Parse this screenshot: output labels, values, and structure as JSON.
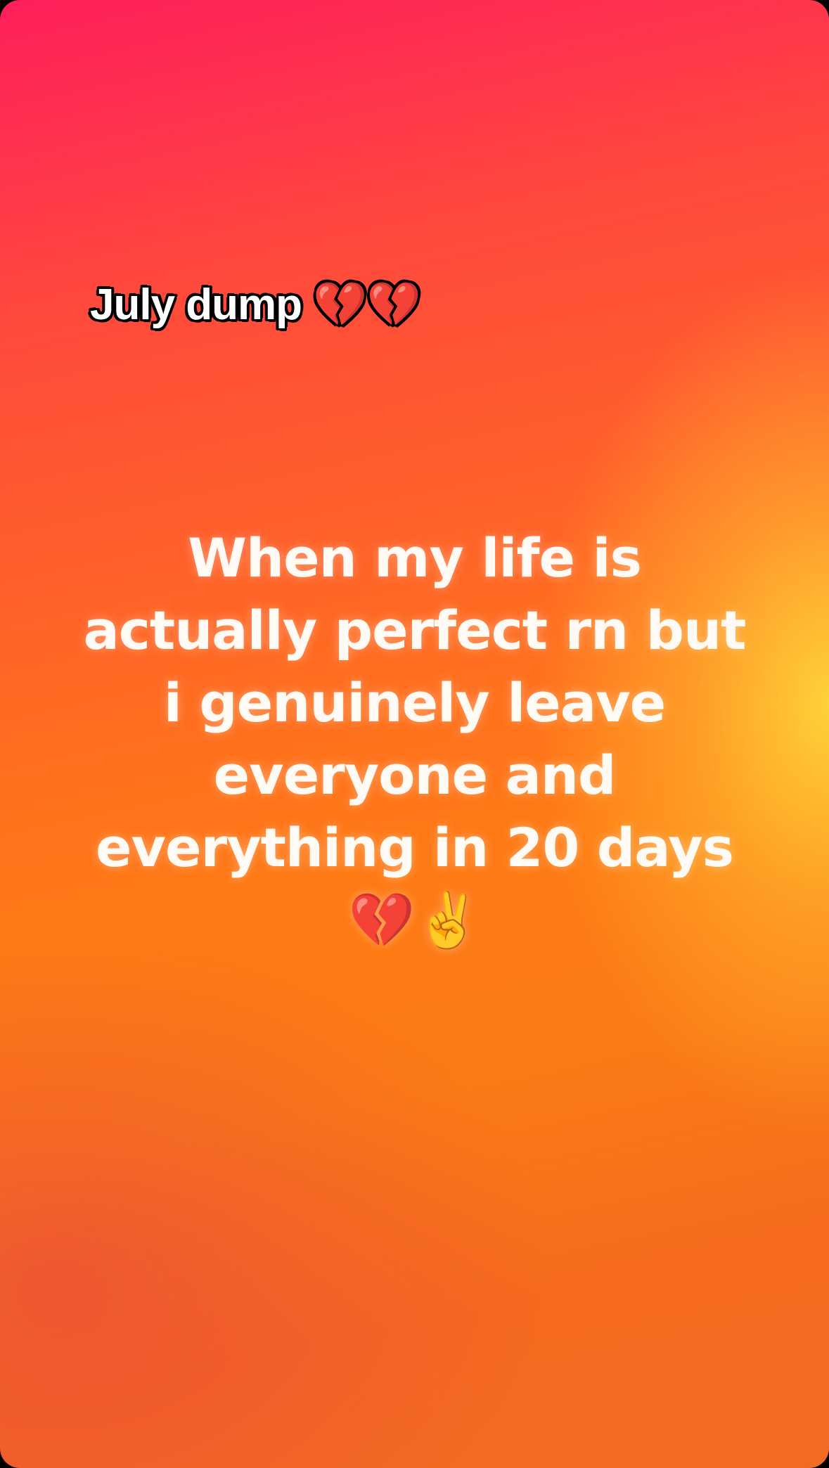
{
  "story": {
    "caption": "July dump 💔💔",
    "body_lines": [
      "When my life is",
      "actually perfect rn but",
      "i genuinely leave",
      "everyone and",
      "everything in 20 days",
      "💔✌️"
    ],
    "colors": {
      "gradient_top": "#ff1f5a",
      "gradient_middle": "#ff6e20",
      "gradient_highlight": "#ffd63c",
      "gradient_bottom": "#f36b23",
      "text": "#ffffff",
      "caption_outline": "#000000"
    }
  }
}
